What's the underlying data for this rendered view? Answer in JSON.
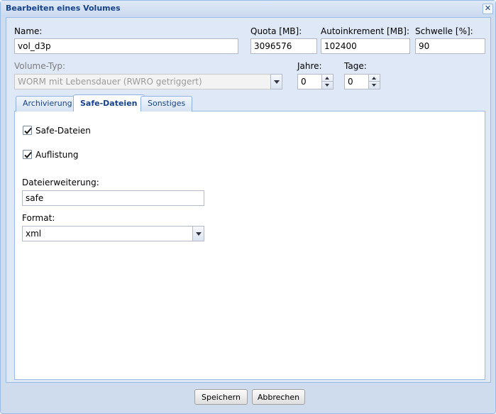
{
  "window": {
    "title": "Bearbeiten eines Volumes",
    "close_icon": "close-icon"
  },
  "fields": {
    "name": {
      "label": "Name:",
      "value": "vol_d3p"
    },
    "quota": {
      "label": "Quota [MB]:",
      "value": "3096576"
    },
    "autoinkrement": {
      "label": "Autoinkrement [MB]:",
      "value": "102400"
    },
    "schwelle": {
      "label": "Schwelle [%]:",
      "value": "90"
    },
    "volume_typ": {
      "label": "Volume-Typ:",
      "value": "WORM mit Lebensdauer (RWRO getriggert)"
    },
    "jahre": {
      "label": "Jahre:",
      "value": "0"
    },
    "tage": {
      "label": "Tage:",
      "value": "0"
    }
  },
  "tabs": [
    {
      "label": "Archivierung",
      "active": false
    },
    {
      "label": "Safe-Dateien",
      "active": true
    },
    {
      "label": "Sonstiges",
      "active": false
    }
  ],
  "safe_tab": {
    "safe_dateien": {
      "label": "Safe-Dateien",
      "checked": true
    },
    "auflistung": {
      "label": "Auflistung",
      "checked": true
    },
    "dateierweiterung": {
      "label": "Dateierweiterung:",
      "value": "safe"
    },
    "format": {
      "label": "Format:",
      "value": "xml"
    }
  },
  "buttons": {
    "save": "Speichern",
    "cancel": "Abbrechen"
  },
  "colors": {
    "title_text": "#15428b",
    "window_border": "#99bbe8",
    "panel_bg": "#dfe8f6"
  }
}
